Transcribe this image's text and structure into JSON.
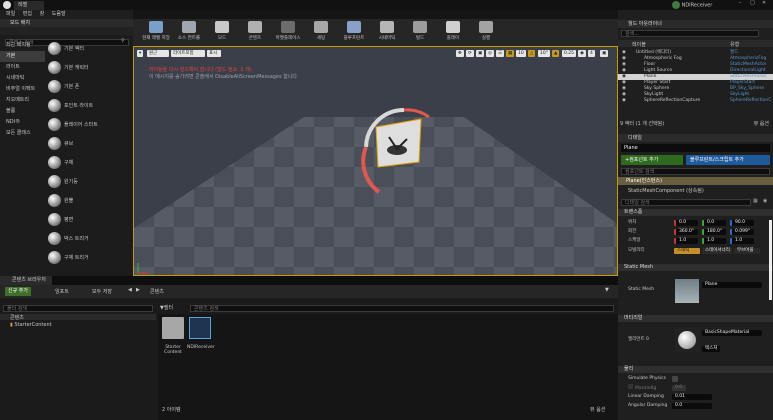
{
  "app": {
    "tab_title": "레벨",
    "ndi_status": "NDIReceiver"
  },
  "menu": [
    "파일",
    "편집",
    "창",
    "도움말"
  ],
  "toolbar": [
    {
      "label": "현재 레벨 저장",
      "color": "#7aa0c8"
    },
    {
      "label": "소스 컨트롤",
      "color": "#9fa6af"
    },
    {
      "label": "모드",
      "color": "#c8c8c8"
    },
    {
      "label": "콘텐츠",
      "color": "#b0b0b0"
    },
    {
      "label": "마켓플레이스",
      "color": "#6d6d6d"
    },
    {
      "label": "세팅",
      "color": "#a7a7a7"
    },
    {
      "label": "블루프린트",
      "color": "#8aa0c8"
    },
    {
      "label": "시네마틱",
      "color": "#b5b5b5"
    },
    {
      "label": "빌드",
      "color": "#9c9c9c"
    },
    {
      "label": "플레이",
      "color": "#d0d0d0"
    },
    {
      "label": "실행",
      "color": "#a3a3a3"
    }
  ],
  "place_modes": {
    "tab": "모드 배치",
    "search_placeholder": "클래스 검색",
    "categories": [
      "최근 배치됨",
      "기본",
      "라이트",
      "시네마틱",
      "비주얼 이펙트",
      "지오메트리",
      "볼륨",
      "NDI®",
      "모든 클래스"
    ],
    "items": [
      "기본 액터",
      "기본 캐릭터",
      "기본 폰",
      "포인트 라이트",
      "플레이어 스타트",
      "큐브",
      "구체",
      "원기둥",
      "원뿔",
      "평면",
      "박스 트리거",
      "구체 트리거"
    ]
  },
  "viewport": {
    "perspective": "원근",
    "lit": "라이트포함",
    "show": "표시",
    "msg_error": "라이팅을 다시 빌드해야 합니다 (빌드 필요: 1 개)",
    "msg_info": "이 메시지를 숨기려면 콘솔에서 DisableAllScreenMessages 합니다",
    "snap": [
      "10",
      "10°",
      "0.25",
      "4"
    ]
  },
  "outliner": {
    "tab": "월드 아웃라이너",
    "search_placeholder": "검색...",
    "col_label": "레이블",
    "col_type": "유형",
    "rows": [
      {
        "label": "Untitled (에디터)",
        "type": "월드"
      },
      {
        "label": "Atmospheric Fog",
        "type": "AtmosphericFog"
      },
      {
        "label": "Floor",
        "type": "StaticMeshActor"
      },
      {
        "label": "Light Source",
        "type": "DirectionalLight"
      },
      {
        "label": "Plane",
        "type": "StaticMeshActor"
      },
      {
        "label": "Player Start",
        "type": "PlayerStart"
      },
      {
        "label": "Sky Sphere",
        "type": "BP_Sky_Sphere"
      },
      {
        "label": "SkyLight",
        "type": "SkyLight"
      },
      {
        "label": "SphereReflectionCapture",
        "type": "SphereReflectionC"
      }
    ],
    "count": "9 액터 (1 개 선택됨)",
    "view_options": "뷰 옵션"
  },
  "details": {
    "tab": "디테일",
    "name": "Plane",
    "add_component": "+컴포넌트 추가",
    "blueprint": "블루프린트/스크립트 추가",
    "search_comp": "컴포넌트 검색",
    "instance": "Plane(인스턴스)",
    "component": "StaticMeshComponent (상속됨)",
    "search_detail": "디테일 검색",
    "transform_hdr": "트랜스폼",
    "location_label": "위치",
    "location": [
      "0.0",
      "0.0",
      "90.0"
    ],
    "rotation_label": "회전",
    "rotation": [
      "360.0°",
      "180.0°",
      "0.099°"
    ],
    "scale_label": "스케일",
    "scale": [
      "1.0",
      "1.0",
      "1.0"
    ],
    "mobility_label": "모빌리티",
    "mobility": [
      "스태틱",
      "스테이셔너리",
      "무브어블"
    ],
    "static_mesh_hdr": "Static Mesh",
    "static_mesh_label": "Static Mesh",
    "mesh_value": "Plane",
    "materials_hdr": "머티리얼",
    "element0": "엘리먼트 0",
    "material_value": "BasicShapeMaterial",
    "texture_label": "텍스처",
    "physics_hdr": "물리",
    "sim_physics": "Simulate Physics",
    "mass": "MassInKg",
    "mass_value": "0.0",
    "linear_damping": "Linear Damping",
    "linear_damping_value": "0.01",
    "angular_damping": "Angular Damping",
    "angular_damping_value": "0.0"
  },
  "content_browser": {
    "tab": "콘텐츠 브라우저",
    "add_new": "신규 추가",
    "import": "임포트",
    "save_all": "모두 저장",
    "path": "콘텐츠",
    "folder_search": "폴더 검색",
    "filter": "필터",
    "asset_search": "콘텐츠 검색",
    "tree": [
      "콘텐츠",
      "StarterContent"
    ],
    "assets": [
      "Starter Content",
      "NDIReceiver"
    ],
    "item_count": "2 아이템",
    "view_options": "뷰 옵션"
  }
}
